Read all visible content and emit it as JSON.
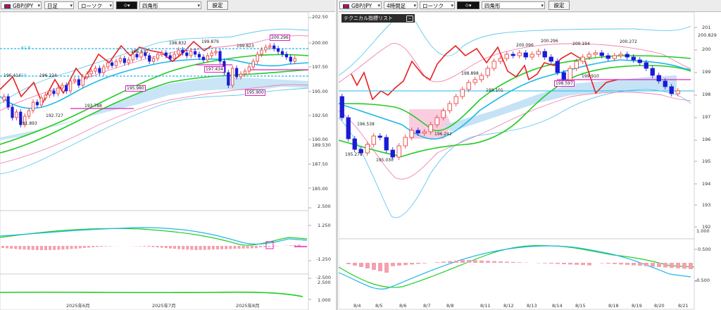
{
  "left": {
    "toolbar": {
      "symbol": "GBP/JPY",
      "timeframe": "日足",
      "chart_style": "ローソク",
      "drawing_tool": "四角形",
      "settings_label": "設定"
    },
    "y_ticks": [
      "202.50",
      "200.00",
      "197.50",
      "195.00",
      "192.50",
      "190.00",
      "189.530",
      "187.50",
      "185.00",
      "2.500",
      "1.250",
      "-1.250",
      "-2.500",
      "2.500",
      "1.000"
    ],
    "x_ticks": [
      "2025年6月",
      "2025年7月",
      "2025年8月"
    ],
    "annotations": [
      "196.414",
      "196.224",
      "191.893",
      "192.727",
      "193.788",
      "196.611",
      "198.832",
      "199.879",
      "195.980",
      "197.434",
      "199.823",
      "200.296",
      "195.900",
      "61.8",
      "50"
    ]
  },
  "right": {
    "toolbar": {
      "symbol": "GBP/JPY",
      "timeframe": "4時間足",
      "chart_style": "ローソク",
      "drawing_tool": "四角形",
      "settings_label": "設定"
    },
    "indicator_list_label": "テクニカル指標リスト",
    "y_ticks": [
      "201",
      "200.829",
      "200",
      "199",
      "198",
      "197",
      "196",
      "195",
      "194",
      "193",
      "192",
      "1.000",
      "0.500",
      "-0.500"
    ],
    "x_ticks": [
      "8/4",
      "8/5",
      "8/6",
      "8/7",
      "8/8",
      "8/11",
      "8/12",
      "8/13",
      "8/14",
      "8/15",
      "8/18",
      "8/19",
      "8/20",
      "8/21"
    ],
    "annotations": [
      "196.538",
      "195.275",
      "195.030",
      "196.242",
      "198.898",
      "198.101",
      "200.096",
      "200.296",
      "200.194",
      "199.910",
      "198.597",
      "200.272"
    ]
  },
  "colors": {
    "up": "#e83030",
    "down": "#1a1ad8",
    "ma_green": "#22cc22",
    "ma_light_blue": "#20b8e8",
    "red_line": "#e82020",
    "cloud_blue": "#bfe0f4",
    "cloud_pink": "#f8c8dc",
    "bb_pink": "#f080b0",
    "bb_blue": "#60c8f0",
    "magenta_box": "#e020c0",
    "hist_pink": "#f4a0b0"
  }
}
